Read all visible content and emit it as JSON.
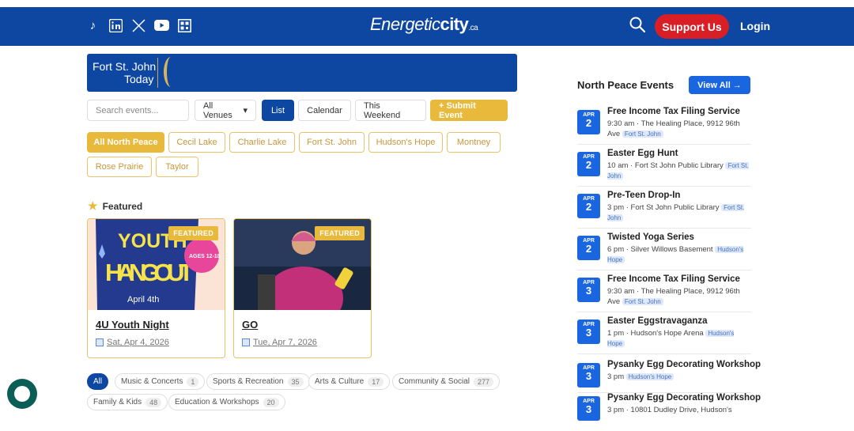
{
  "header": {
    "social_icons": [
      "tiktok-icon",
      "linkedin-icon",
      "x-icon",
      "youtube-icon",
      "qr-code-icon"
    ],
    "brand_main": "Energetic",
    "brand_bold": "city",
    "brand_suffix": ".ca",
    "support_label": "Support Us",
    "login_label": "Login"
  },
  "banner": {
    "line1": "Fort St. John",
    "line2": "Today"
  },
  "controls": {
    "search_placeholder": "Search events...",
    "venue_label": "All Venues",
    "list_label": "List",
    "calendar_label": "Calendar",
    "weekend_label": "This Weekend",
    "submit_label": "+ Submit Event"
  },
  "areas": [
    "All North Peace",
    "Cecil Lake",
    "Charlie Lake",
    "Fort St. John",
    "Hudson's Hope",
    "Montney",
    "Rose Prairie",
    "Taylor"
  ],
  "featured": {
    "heading": "Featured",
    "badge": "FEATURED",
    "cards": [
      {
        "title": "4U Youth Night",
        "date": "Sat, Apr 4, 2026",
        "img_text1": "YOUTH",
        "img_text2": "HANGOUT",
        "img_text3": "April 4th",
        "img_ages": "AGES 12-18"
      },
      {
        "title": "GO",
        "date": "Tue, Apr 7, 2026"
      }
    ]
  },
  "categories": [
    {
      "label": "All",
      "count": ""
    },
    {
      "label": "Music & Concerts",
      "count": "1"
    },
    {
      "label": "Sports & Recreation",
      "count": "35"
    },
    {
      "label": "Arts & Culture",
      "count": "17"
    },
    {
      "label": "Community & Social",
      "count": "277"
    },
    {
      "label": "Family & Kids",
      "count": "48"
    },
    {
      "label": "Education & Workshops",
      "count": "20"
    }
  ],
  "north_peace": {
    "heading": "North Peace Events",
    "view_all": "View All →",
    "events": [
      {
        "month": "APR",
        "day": "2",
        "name": "Free Income Tax Filing Service",
        "info": "9:30 am · The Healing Place, 9912 96th Ave",
        "tag": "Fort St. John"
      },
      {
        "month": "APR",
        "day": "2",
        "name": "Easter Egg Hunt",
        "info": "10 am · Fort St John Public Library",
        "tag": "Fort St. John"
      },
      {
        "month": "APR",
        "day": "2",
        "name": "Pre-Teen Drop-In",
        "info": "3 pm · Fort St John Public Library",
        "tag": "Fort St. John"
      },
      {
        "month": "APR",
        "day": "2",
        "name": "Twisted Yoga Series",
        "info": "6 pm · Silver Willows Basement",
        "tag": "Hudson's Hope"
      },
      {
        "month": "APR",
        "day": "3",
        "name": "Free Income Tax Filing Service",
        "info": "9:30 am · The Healing Place, 9912 96th Ave",
        "tag": "Fort St. John"
      },
      {
        "month": "APR",
        "day": "3",
        "name": "Easter Eggstravaganza",
        "info": "1 pm · Hudson's Hope Arena",
        "tag": "Hudson's Hope"
      },
      {
        "month": "APR",
        "day": "3",
        "name": "Pysanky Egg Decorating Workshop",
        "info": "3 pm",
        "tag": "Hudson's Hope"
      },
      {
        "month": "APR",
        "day": "3",
        "name": "Pysanky Egg Decorating Workshop",
        "info": "3 pm · 10801 Dudley Drive, Hudson's",
        "tag": ""
      }
    ]
  },
  "colors": {
    "brand_blue": "#0d47a1",
    "accent_gold": "#e8b93b",
    "support_red": "#d91f26",
    "date_blue": "#1a66e0"
  }
}
